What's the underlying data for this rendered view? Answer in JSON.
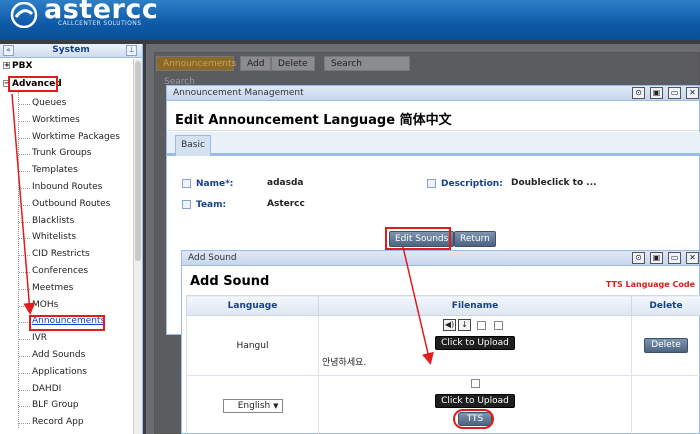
{
  "header": {
    "logo": "astercc",
    "tagline": "CALLCENTER SOLUTIONS"
  },
  "sidebar": {
    "title": "System",
    "collapse_icon": "«",
    "pin_icon": "⊥",
    "top_items": [
      {
        "label": "PBX",
        "expander": "+"
      },
      {
        "label": "Advanced",
        "expander": "−"
      }
    ],
    "children": [
      "Queues",
      "Worktimes",
      "Worktime Packages",
      "Trunk Groups",
      "Templates",
      "Inbound Routes",
      "Outbound Routes",
      "Blacklists",
      "Whitelists",
      "CID Restricts",
      "Conferences",
      "Meetmes",
      "MOHs",
      "Announcements",
      "IVR",
      "Add Sounds",
      "Applications",
      "DAHDI",
      "BLF Group",
      "Record App"
    ]
  },
  "background": {
    "tabs": [
      "Announcements",
      "Add",
      "Delete"
    ],
    "search_placeholder": "Search",
    "search_label": "Search"
  },
  "edit_window": {
    "bar_title": "Announcement Management",
    "heading": "Edit Announcement Language 简体中文",
    "tab": "Basic",
    "fields": {
      "name_label": "Name*:",
      "name_value": "adasda",
      "description_label": "Description:",
      "description_value": "Doubleclick to ...",
      "team_label": "Team:",
      "team_value": "Astercc"
    },
    "buttons": {
      "edit_sounds": "Edit Sounds",
      "return": "Return"
    }
  },
  "add_sound_window": {
    "bar_title": "Add Sound",
    "heading": "Add Sound",
    "tts_link": "TTS Language Code",
    "columns": [
      "Language",
      "Filename",
      "Delete"
    ],
    "rows": [
      {
        "language": "Hangul",
        "upload": "Click to Upload",
        "text": "안녕하세요.",
        "delete": "Delete"
      },
      {
        "language": "English",
        "upload": "Click to Upload",
        "tts": "TTS"
      }
    ]
  },
  "icons": {
    "window_tools": [
      "⊙",
      "▣",
      "▭",
      "✕"
    ],
    "play": "◀)",
    "download": "↓",
    "select_arrow": "▼"
  },
  "colors": {
    "highlight": "#e21b1b",
    "accent": "#15428b",
    "header": "#0d5aa8"
  }
}
